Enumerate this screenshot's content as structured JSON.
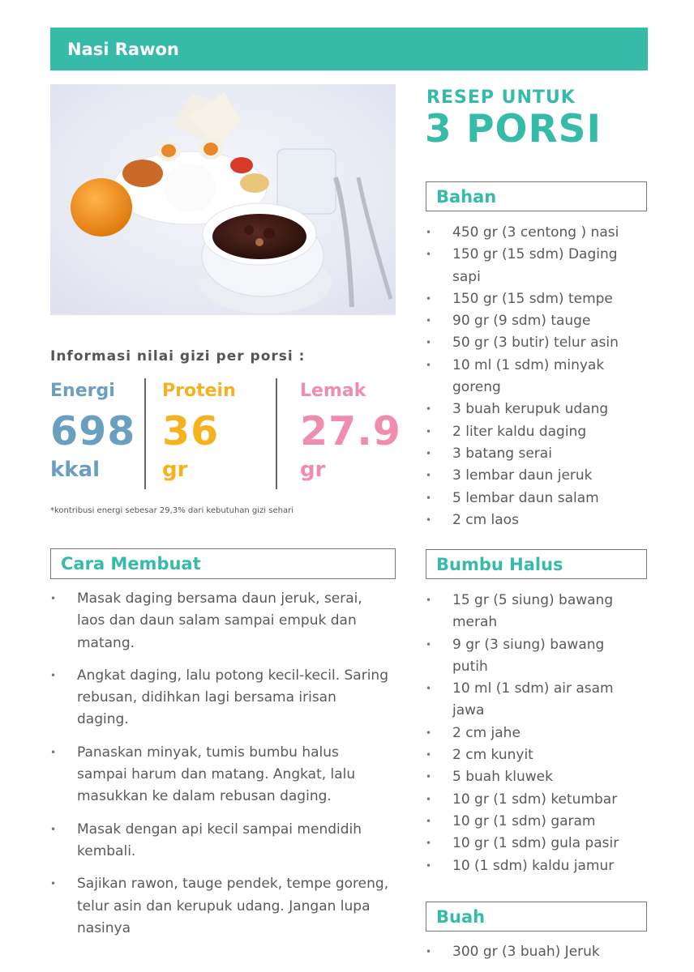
{
  "title": "Nasi Rawon",
  "recipe_for": "RESEP UNTUK",
  "portions": "3 PORSI",
  "nutrition": {
    "title": "Informasi nilai gizi per porsi :",
    "energy": {
      "label": "Energi",
      "value": "698",
      "unit": "kkal",
      "color": "#6a9fc0"
    },
    "protein": {
      "label": "Protein",
      "value": "36",
      "unit": "gr",
      "color": "#f5b21f"
    },
    "fat": {
      "label": "Lemak",
      "value": "27.9",
      "unit": "gr",
      "color": "#f08cb0"
    },
    "note": "*kontribusi energi sebesar 29,3% dari kebutuhan gizi sehari"
  },
  "sections": {
    "bahan": {
      "title": "Bahan",
      "items": [
        "450 gr (3 centong ) nasi",
        "150 gr (15 sdm) Daging sapi",
        "150 gr (15 sdm) tempe",
        "90 gr (9 sdm) tauge",
        "50 gr (3 butir) telur asin",
        "10 ml (1 sdm) minyak goreng",
        "3 buah kerupuk udang",
        "2 liter kaldu daging",
        "3 batang serai",
        "3 lembar daun jeruk",
        "5 lembar daun salam",
        "2 cm laos"
      ]
    },
    "bumbu": {
      "title": "Bumbu Halus",
      "items": [
        "15 gr (5 siung) bawang merah",
        "9 gr (3 siung) bawang putih",
        "10 ml (1 sdm) air asam jawa",
        "2 cm jahe",
        "2 cm kunyit",
        "5 buah kluwek",
        "10 gr (1 sdm) ketumbar",
        "10 gr (1 sdm) garam",
        "10 gr (1 sdm) gula pasir",
        "10 (1 sdm) kaldu jamur"
      ]
    },
    "buah": {
      "title": "Buah",
      "items": [
        "300 gr (3 buah) Jeruk"
      ]
    },
    "cara": {
      "title": "Cara Membuat",
      "steps": [
        "Masak daging bersama daun jeruk, serai, laos dan daun salam sampai empuk dan matang.",
        "Angkat daging, lalu potong kecil-kecil. Saring rebusan, didihkan lagi bersama irisan daging.",
        "Panaskan minyak, tumis bumbu halus sampai harum dan matang. Angkat, lalu masukkan ke dalam rebusan daging.",
        "Masak dengan api kecil sampai mendidih kembali.",
        "Sajikan rawon, tauge pendek, tempe goreng, telur asin dan kerupuk udang. Jangan lupa nasinya"
      ]
    }
  }
}
